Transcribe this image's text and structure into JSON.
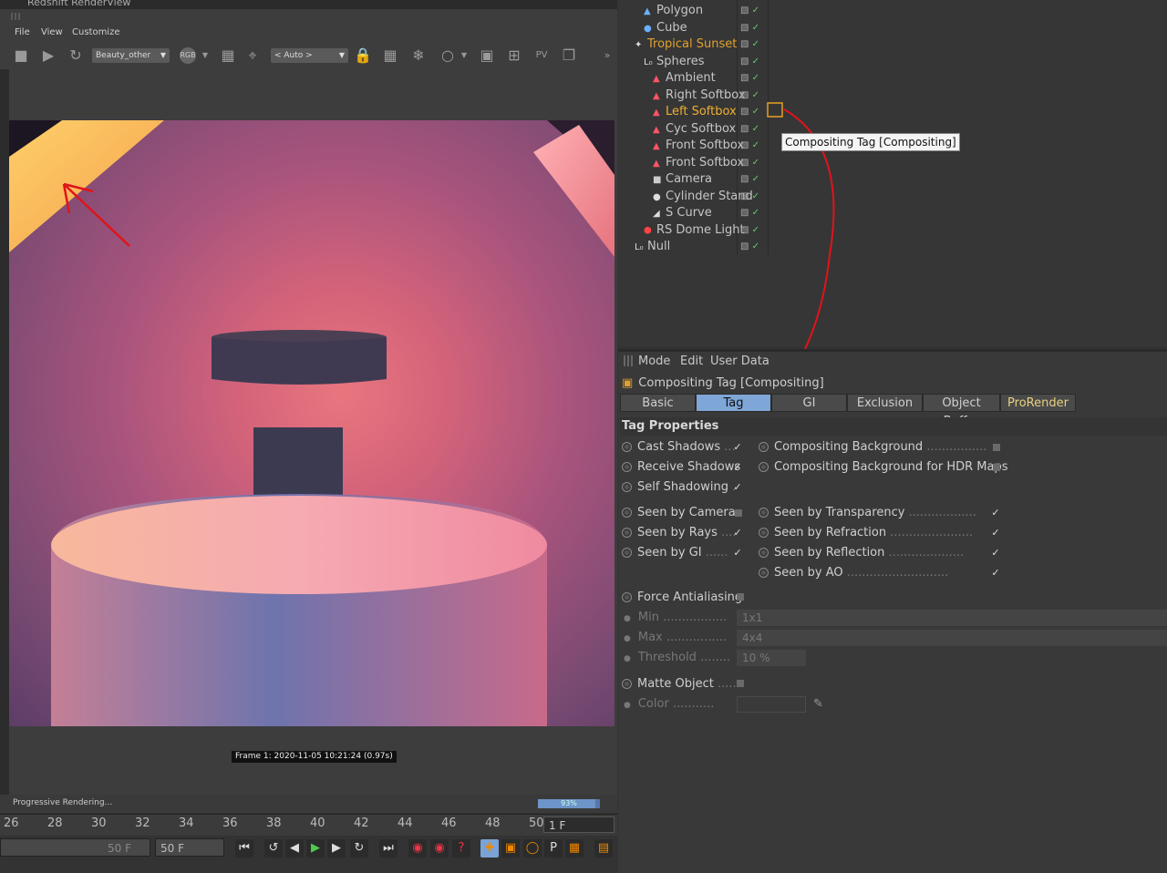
{
  "render_view": {
    "title": "Redshift RenderView",
    "menu": [
      "File",
      "View",
      "Customize"
    ],
    "aov_select": "Beauty_other",
    "channel": "RGB",
    "zoom_select": "< Auto >",
    "frame_info": "Frame  1:  2020-11-05  10:21:24  (0.97s)",
    "status": "Progressive Rendering...",
    "progress": 0.93,
    "progress_label": "93%"
  },
  "timeline": {
    "ticks": [
      "26",
      "28",
      "30",
      "32",
      "34",
      "36",
      "38",
      "40",
      "42",
      "44",
      "46",
      "48",
      "50"
    ],
    "end_frame": "1 F",
    "field_a": "50 F",
    "field_b": "50 F"
  },
  "object_manager": {
    "objects": [
      {
        "label": "Polygon",
        "icon": "polygon-icon",
        "color": "#c6c6c6",
        "indent": 1
      },
      {
        "label": "Cube",
        "icon": "cube-icon",
        "color": "#c6c6c6",
        "indent": 1
      },
      {
        "label": "Tropical Sunset",
        "icon": "null-icon",
        "color": "#e0a030",
        "indent": 0
      },
      {
        "label": "Spheres",
        "icon": "null-group-icon",
        "color": "#c6c6c6",
        "indent": 1
      },
      {
        "label": "Ambient",
        "icon": "light-icon",
        "color": "#c6c6c6",
        "indent": 2
      },
      {
        "label": "Right Softbox",
        "icon": "light-icon",
        "color": "#c6c6c6",
        "indent": 2
      },
      {
        "label": "Left Softbox",
        "icon": "light-icon",
        "color": "#f0b030",
        "indent": 2
      },
      {
        "label": "Cyc Softbox",
        "icon": "light-icon",
        "color": "#c6c6c6",
        "indent": 2
      },
      {
        "label": "Front Softbox",
        "icon": "light-icon",
        "color": "#c6c6c6",
        "indent": 2
      },
      {
        "label": "Front Softbox",
        "icon": "light-icon",
        "color": "#c6c6c6",
        "indent": 2
      },
      {
        "label": "Camera",
        "icon": "camera-icon",
        "color": "#c6c6c6",
        "indent": 2
      },
      {
        "label": "Cylinder Stand",
        "icon": "cylinder-icon",
        "color": "#c6c6c6",
        "indent": 2
      },
      {
        "label": "S Curve",
        "icon": "curve-icon",
        "color": "#c6c6c6",
        "indent": 2
      },
      {
        "label": "RS Dome Light",
        "icon": "dome-light-icon",
        "color": "#c6c6c6",
        "indent": 1
      },
      {
        "label": "Null",
        "icon": "null-group-icon",
        "color": "#c6c6c6",
        "indent": 0
      }
    ],
    "tooltip": "Compositing Tag [Compositing]"
  },
  "attribute_manager": {
    "menu": [
      "Mode",
      "Edit",
      "User Data"
    ],
    "title": "Compositing Tag [Compositing]",
    "tabs": [
      {
        "label": "Basic",
        "active": false
      },
      {
        "label": "Tag",
        "active": true
      },
      {
        "label": "GI",
        "active": false
      },
      {
        "label": "Exclusion",
        "active": false
      },
      {
        "label": "Object Buffer",
        "active": false
      },
      {
        "label": "ProRender",
        "active": false
      }
    ],
    "section": "Tag Properties",
    "left_props": [
      {
        "label": "Cast Shadows",
        "checked": true
      },
      {
        "label": "Receive Shadows",
        "checked": true
      },
      {
        "label": "Self Shadowing",
        "checked": true
      },
      {
        "label": "Seen by Camera",
        "checked": false
      },
      {
        "label": "Seen by Rays",
        "checked": true
      },
      {
        "label": "Seen by GI",
        "checked": true
      }
    ],
    "right_props": [
      {
        "label": "Compositing Background",
        "checked": false
      },
      {
        "label": "Compositing Background for HDR Maps",
        "checked": false
      },
      {
        "label": "Seen by Transparency",
        "checked": true
      },
      {
        "label": "Seen by Refraction",
        "checked": true
      },
      {
        "label": "Seen by Reflection",
        "checked": true
      },
      {
        "label": "Seen by AO",
        "checked": true
      }
    ],
    "force_aa": "Force Antialiasing",
    "min_label": "Min",
    "min_value": "1x1",
    "max_label": "Max",
    "max_value": "4x4",
    "threshold_label": "Threshold",
    "threshold_value": "10 %",
    "matte_label": "Matte Object",
    "color_label": "Color"
  }
}
